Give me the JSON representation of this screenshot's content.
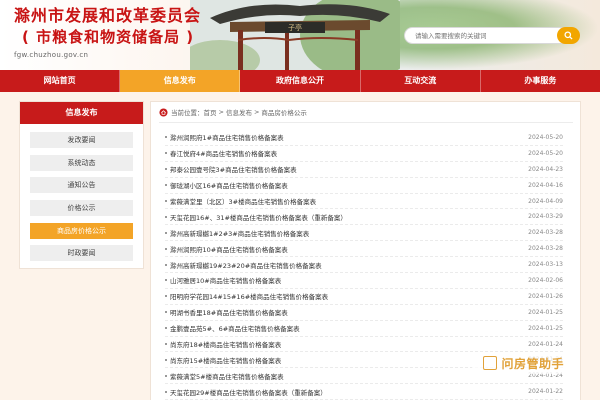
{
  "header": {
    "title_line1": "滁州市发展和改革委员会",
    "title_line2": "( 市粮食和物资储备局 )",
    "domain": "fgw.chuzhou.gov.cn",
    "pavilion_sign": "子亭"
  },
  "search": {
    "placeholder": "请输入需要搜索的关键词"
  },
  "nav": [
    {
      "label": "网站首页",
      "active": false
    },
    {
      "label": "信息发布",
      "active": true
    },
    {
      "label": "政府信息公开",
      "active": false
    },
    {
      "label": "互动交流",
      "active": false
    },
    {
      "label": "办事服务",
      "active": false
    }
  ],
  "sidebar": {
    "title": "信息发布",
    "items": [
      {
        "label": "发改要闻",
        "active": false
      },
      {
        "label": "系统动态",
        "active": false
      },
      {
        "label": "通知公告",
        "active": false
      },
      {
        "label": "价格公示",
        "active": false
      },
      {
        "label": "商品房价格公示",
        "active": true
      },
      {
        "label": "时政要闻",
        "active": false
      }
    ]
  },
  "breadcrumb": {
    "prefix": "当前位置：",
    "parts": [
      "首页",
      "信息发布",
      "商品房价格公示"
    ]
  },
  "list": [
    {
      "title": "滁州润熙府1#商品住宅销售价格备案表",
      "date": "2024-05-20"
    },
    {
      "title": "春江悦府4#商品住宅销售价格备案表",
      "date": "2024-05-20"
    },
    {
      "title": "邦泰公园壹号院3#商品住宅销售价格备案表",
      "date": "2024-04-23"
    },
    {
      "title": "御珑湖小区16#商品住宅销售价格备案表",
      "date": "2024-04-16"
    },
    {
      "title": "紫薇满堂里（北区）3#楼商品住宅销售价格备案表",
      "date": "2024-04-09"
    },
    {
      "title": "天玺花园16#、31#楼商品住宅销售价格备案表（重新备案）",
      "date": "2024-03-29"
    },
    {
      "title": "滁州高新璟樾1#2#3#商品住宅销售价格备案表",
      "date": "2024-03-28"
    },
    {
      "title": "滁州润熙府10#商品住宅销售价格备案表",
      "date": "2024-03-28"
    },
    {
      "title": "滁州高新璟樾19#23#20#商品住宅销售价格备案表",
      "date": "2024-03-13"
    },
    {
      "title": "山河雅居10#商品住宅销售价格备案表",
      "date": "2024-02-06"
    },
    {
      "title": "阳明府学花园14#15#16#楼商品住宅销售价格备案表",
      "date": "2024-01-26"
    },
    {
      "title": "明湖书香里18#商品住宅销售价格备案表",
      "date": "2024-01-25"
    },
    {
      "title": "金鹏壹品苑5#、6#商品住宅销售价格备案表",
      "date": "2024-01-25"
    },
    {
      "title": "尚东府18#楼商品住宅销售价格备案表",
      "date": "2024-01-24"
    },
    {
      "title": "尚东府15#楼商品住宅销售价格备案表",
      "date": "2024-01-24"
    },
    {
      "title": "紫薇满堂5#楼商品住宅销售价格备案表",
      "date": "2024-01-24"
    },
    {
      "title": "天玺花园29#楼商品住宅销售价格备案表（重新备案）",
      "date": "2024-01-22"
    }
  ],
  "watermark": {
    "text": "问房管助手"
  },
  "colors": {
    "primary_red": "#c71b1b",
    "accent_orange": "#f3a427",
    "title_red": "#c81414"
  }
}
